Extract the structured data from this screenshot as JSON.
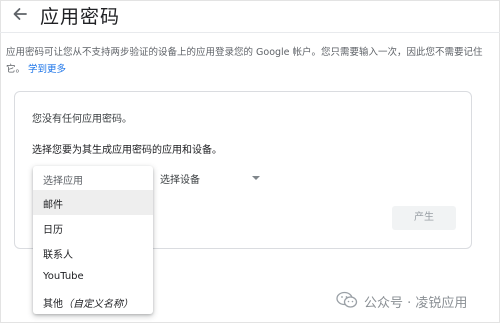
{
  "header": {
    "title": "应用密码",
    "back_icon": "arrow-left-icon"
  },
  "description": {
    "text": "应用密码可让您从不支持两步验证的设备上的应用登录您的 Google 帐户。您只需要输入一次，因此您不需要记住它。",
    "link": "学到更多"
  },
  "card": {
    "no_passwords": "您没有任何应用密码。",
    "choose_prompt": "选择您要为其生成应用密码的应用和设备。",
    "device_select": {
      "label": "选择设备",
      "icon": "caret-down-icon"
    },
    "generate_button": "产生"
  },
  "app_dropdown": {
    "header": "选择应用",
    "items": [
      {
        "label": "邮件",
        "highlighted": true
      },
      {
        "label": "日历"
      },
      {
        "label": "联系人"
      },
      {
        "label": "YouTube"
      },
      {
        "label": "其他",
        "hint": "（自定义名称）"
      }
    ]
  },
  "watermark": {
    "text": "公众号 · 凌锐应用",
    "icon": "wechat-icon"
  },
  "colors": {
    "link": "#1a73e8",
    "text": "#3c4043",
    "disabled": "#9aa0a6"
  }
}
